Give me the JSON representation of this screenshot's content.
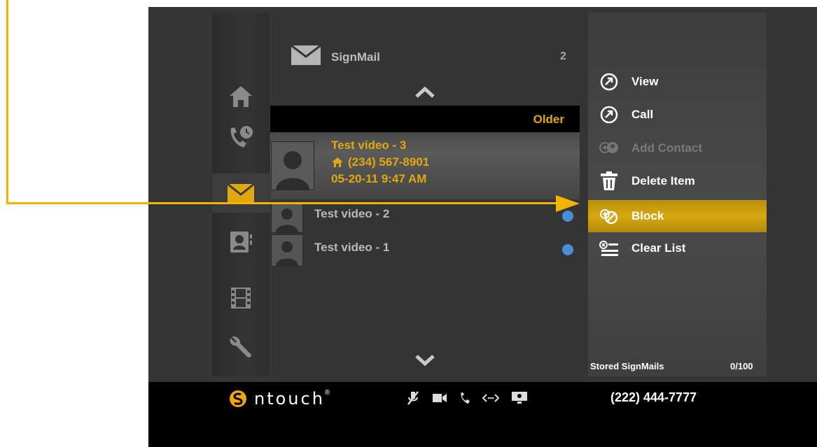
{
  "list": {
    "header_title": "SignMail",
    "header_count": "2",
    "older_label": "Older",
    "selected": {
      "name": "Test video - 3",
      "phone": "(234) 567-8901",
      "datetime": "05-20-11  9:47 AM"
    },
    "items": [
      {
        "name": "Test video - 2"
      },
      {
        "name": "Test video - 1"
      }
    ]
  },
  "menu": {
    "items": [
      {
        "label": "View",
        "icon": "arrow-circle-icon",
        "enabled": true
      },
      {
        "label": "Call",
        "icon": "arrow-circle-icon",
        "enabled": true
      },
      {
        "label": "Add Contact",
        "icon": "add-contact-icon",
        "enabled": false
      },
      {
        "label": "Delete Item",
        "icon": "trash-icon",
        "enabled": true
      },
      {
        "label": "Block",
        "icon": "block-icon",
        "enabled": true,
        "highlighted": true
      },
      {
        "label": "Clear List",
        "icon": "clear-list-icon",
        "enabled": true
      }
    ],
    "stored_label": "Stored SignMails",
    "stored_count": "0/100"
  },
  "nav": [
    "home-icon",
    "call-history-icon",
    "signmail-icon",
    "contacts-icon",
    "video-center-icon",
    "settings-icon"
  ],
  "bottom": {
    "brand": "ntouch",
    "brand_mark": "®",
    "phone_number": "(222) 444-7777"
  },
  "colors": {
    "accent": "#e1a80e",
    "callout": "#f5b300",
    "unread_dot": "#4a8ed4"
  }
}
